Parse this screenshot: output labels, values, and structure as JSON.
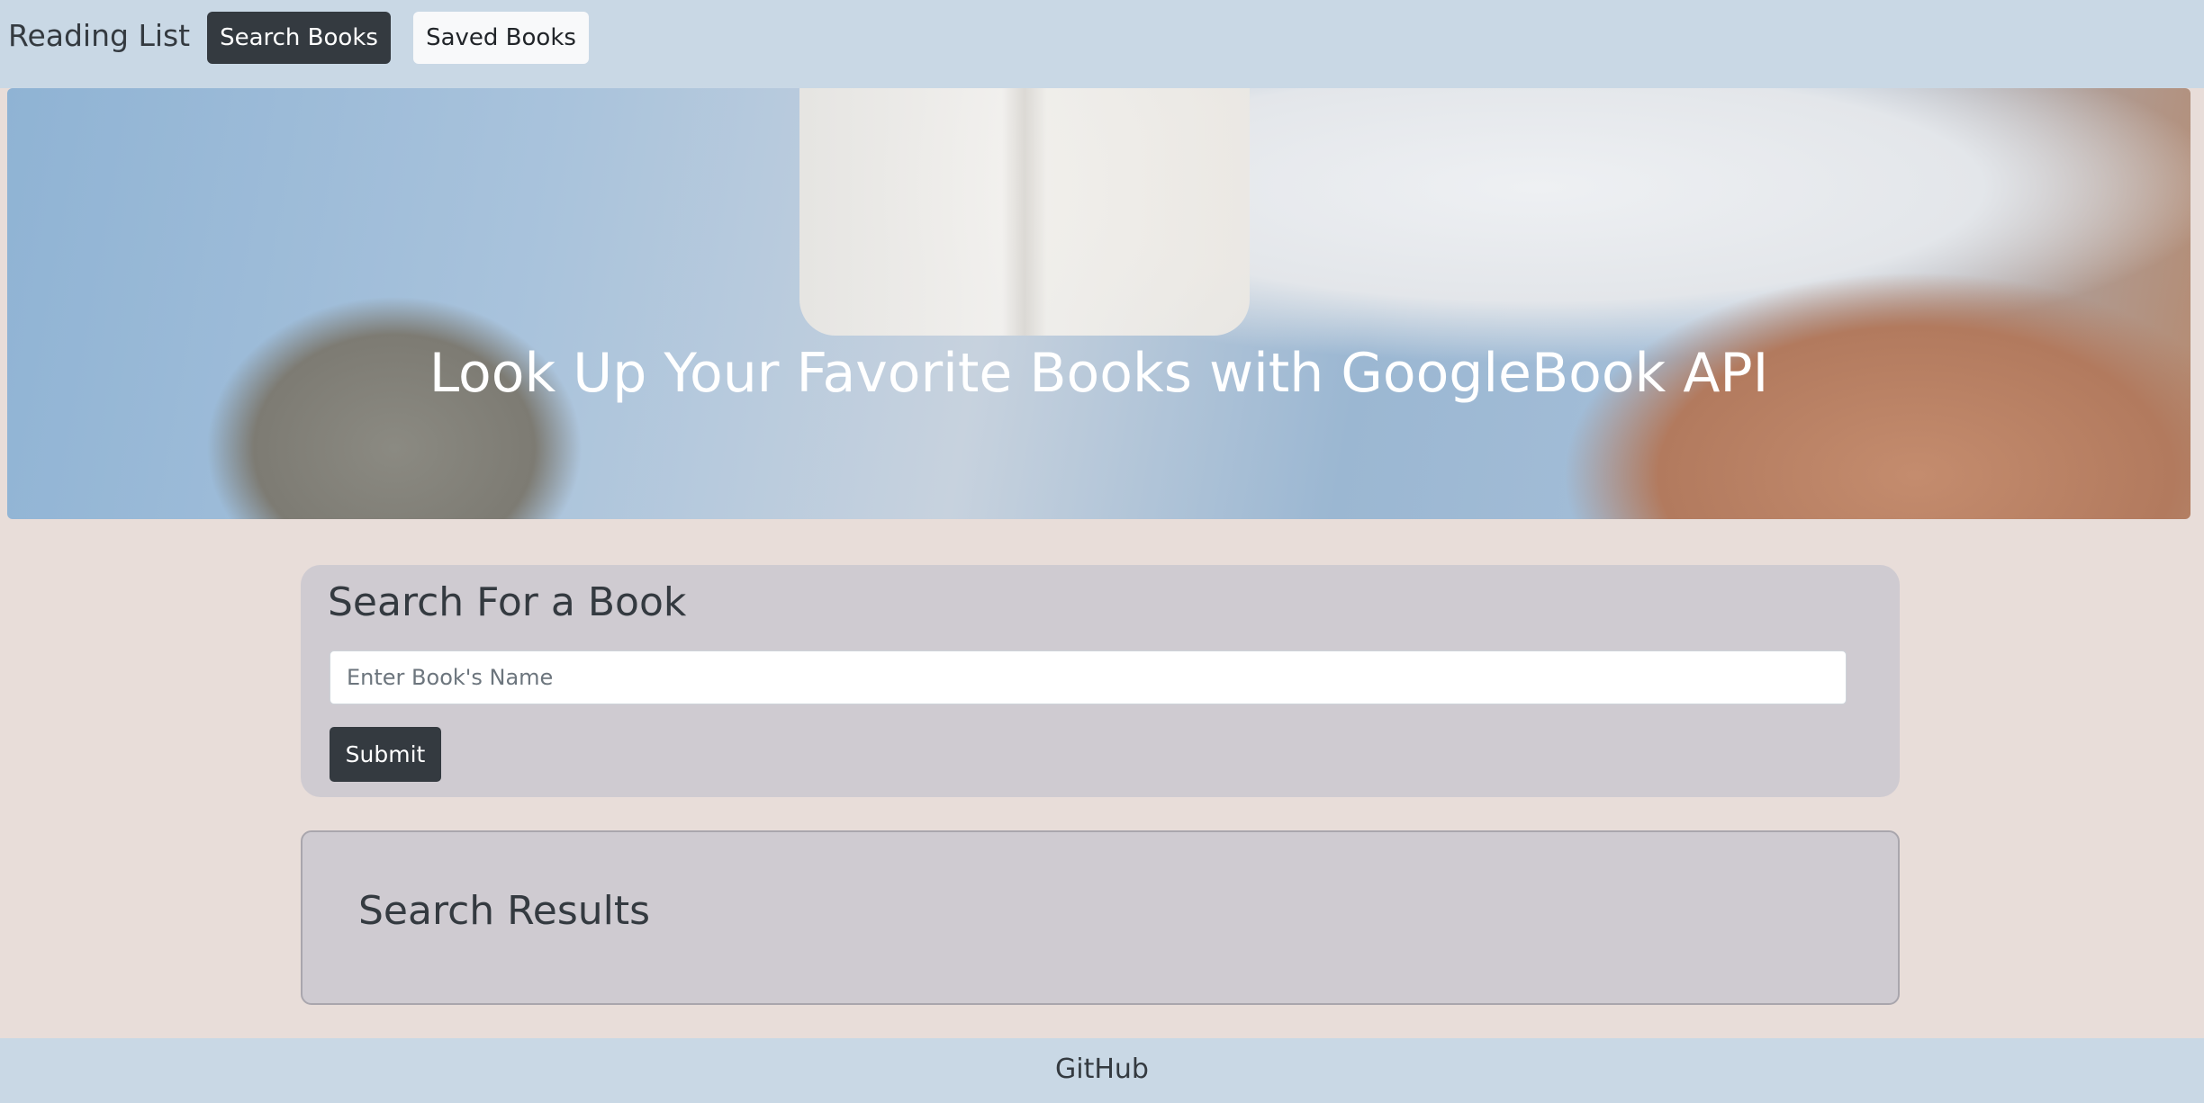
{
  "navbar": {
    "brand": "Reading List",
    "buttons": [
      {
        "label": "Search Books",
        "active": true
      },
      {
        "label": "Saved Books",
        "active": false
      }
    ]
  },
  "hero": {
    "title": "Look Up Your Favorite Books with GoogleBook API",
    "background_image": "person-reading-book-in-jeans"
  },
  "search": {
    "title": "Search For a Book",
    "input_placeholder": "Enter Book's Name",
    "input_value": "",
    "submit_label": "Submit"
  },
  "results": {
    "title": "Search Results"
  },
  "footer": {
    "link_label": "GitHub"
  },
  "colors": {
    "navbar_bg": "#c9d8e5",
    "page_bg": "#e8ddd9",
    "card_bg": "#cfcbd1",
    "dark_button": "#343a40",
    "light_button": "#f8f9fa",
    "text": "#343a40"
  }
}
